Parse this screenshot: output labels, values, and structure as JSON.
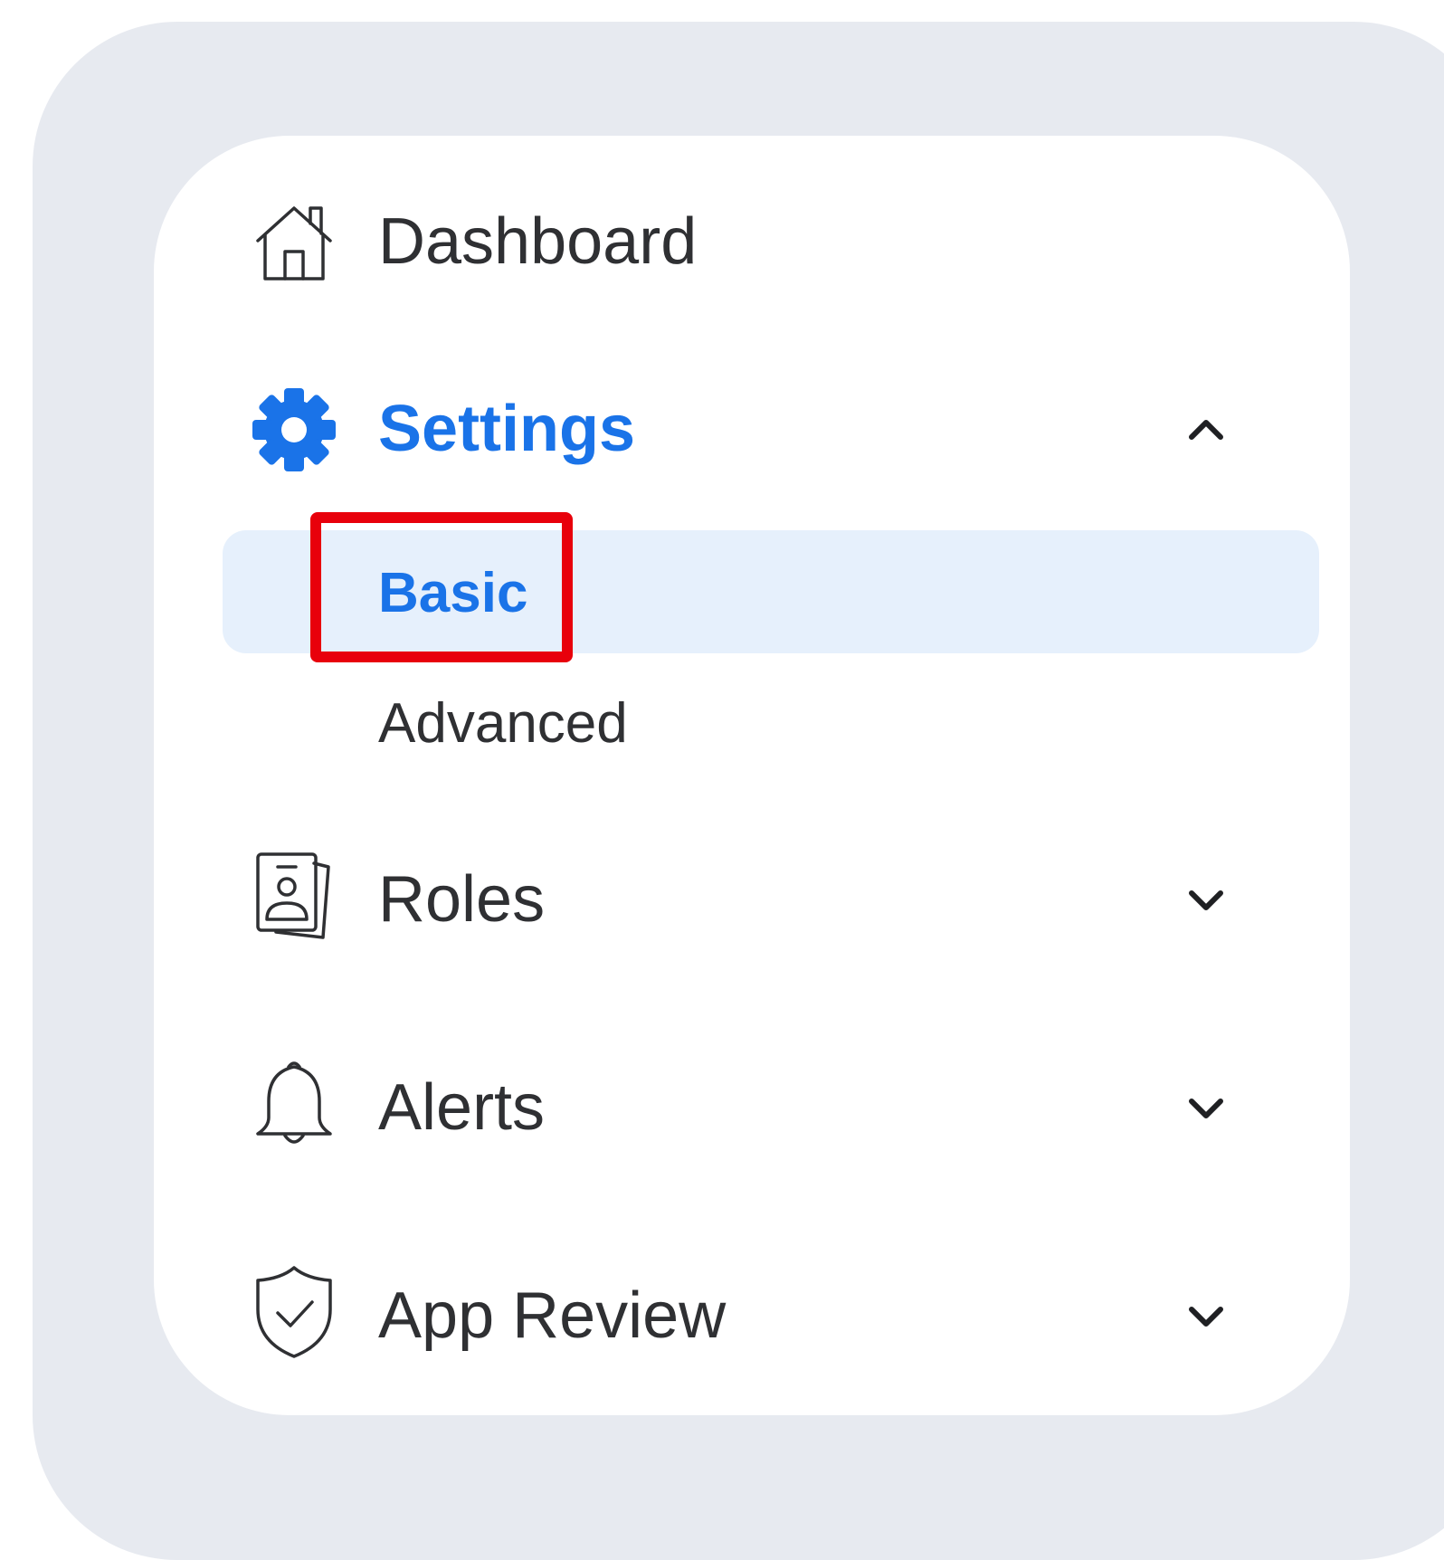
{
  "nav": {
    "items": [
      {
        "key": "dashboard",
        "label": "Dashboard",
        "icon": "house-icon",
        "expanded": false,
        "has_chevron": false
      },
      {
        "key": "settings",
        "label": "Settings",
        "icon": "gear-icon",
        "expanded": true,
        "has_chevron": true,
        "children": [
          {
            "key": "basic",
            "label": "Basic",
            "selected": true
          },
          {
            "key": "advanced",
            "label": "Advanced",
            "selected": false
          }
        ]
      },
      {
        "key": "roles",
        "label": "Roles",
        "icon": "id-badge-icon",
        "expanded": false,
        "has_chevron": true
      },
      {
        "key": "alerts",
        "label": "Alerts",
        "icon": "bell-icon",
        "expanded": false,
        "has_chevron": true
      },
      {
        "key": "app-review",
        "label": "App Review",
        "icon": "shield-check-icon",
        "expanded": false,
        "has_chevron": true
      }
    ]
  },
  "colors": {
    "accent": "#1a73e8",
    "selected_bg": "#e6f0fc",
    "text": "#2f3033",
    "highlight": "#e8000b",
    "frame_bg": "#e7eaf0"
  }
}
